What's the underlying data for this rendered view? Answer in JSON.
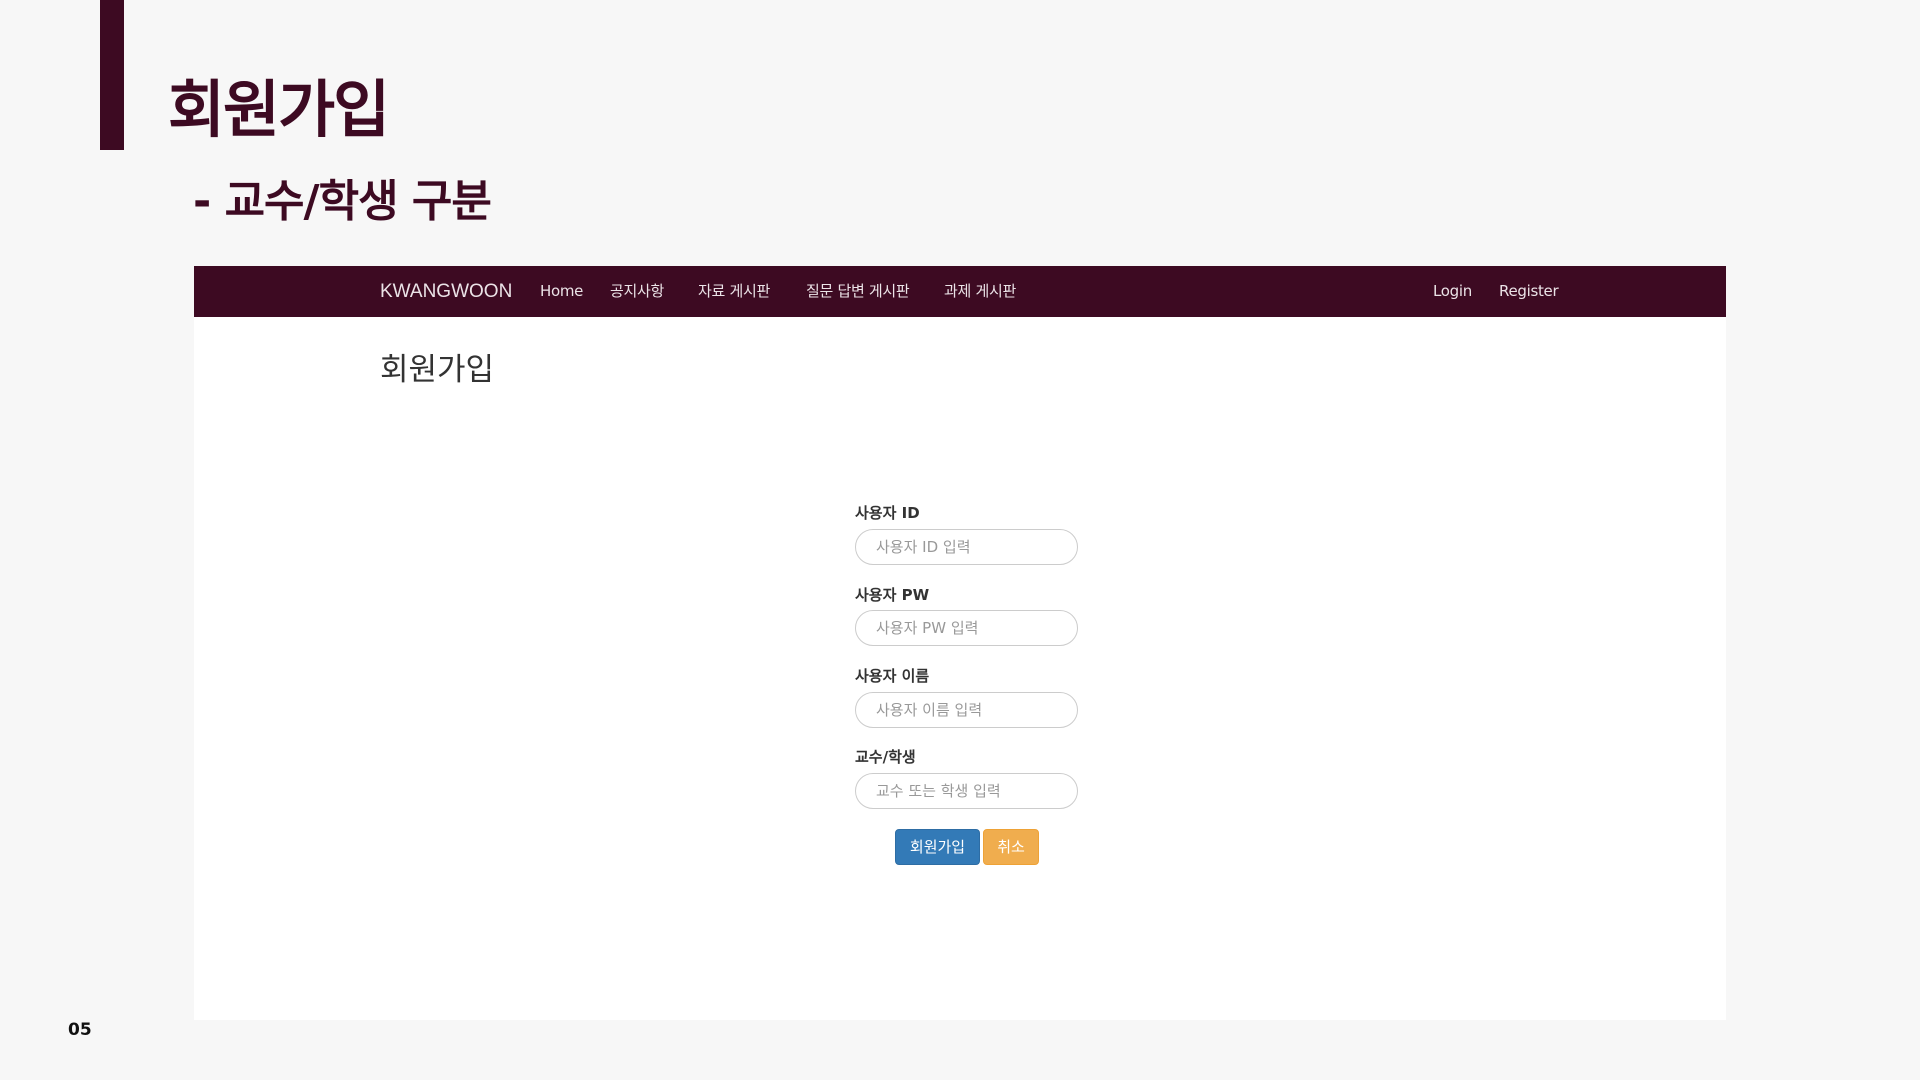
{
  "slide": {
    "title": "회원가입",
    "subtitle": "- 교수/학생 구분",
    "page_number": "05"
  },
  "navbar": {
    "brand": "KWANGWOON",
    "links": [
      "Home",
      "공지사항",
      "자료 게시판",
      "질문 답변 게시판",
      "과제 게시판"
    ],
    "right_links": [
      "Login",
      "Register"
    ]
  },
  "page": {
    "heading": "회원가입"
  },
  "form": {
    "fields": [
      {
        "label": "사용자 ID",
        "placeholder": "사용자 ID 입력"
      },
      {
        "label": "사용자 PW",
        "placeholder": "사용자 PW 입력"
      },
      {
        "label": "사용자 이름",
        "placeholder": "사용자 이름 입력"
      },
      {
        "label": "교수/학생",
        "placeholder": "교수 또는 학생 입력"
      }
    ],
    "submit_label": "회원가입",
    "cancel_label": "취소"
  },
  "colors": {
    "brand": "#3d0a22",
    "primary_button": "#337ab7",
    "warning_button": "#f0ad4e"
  }
}
